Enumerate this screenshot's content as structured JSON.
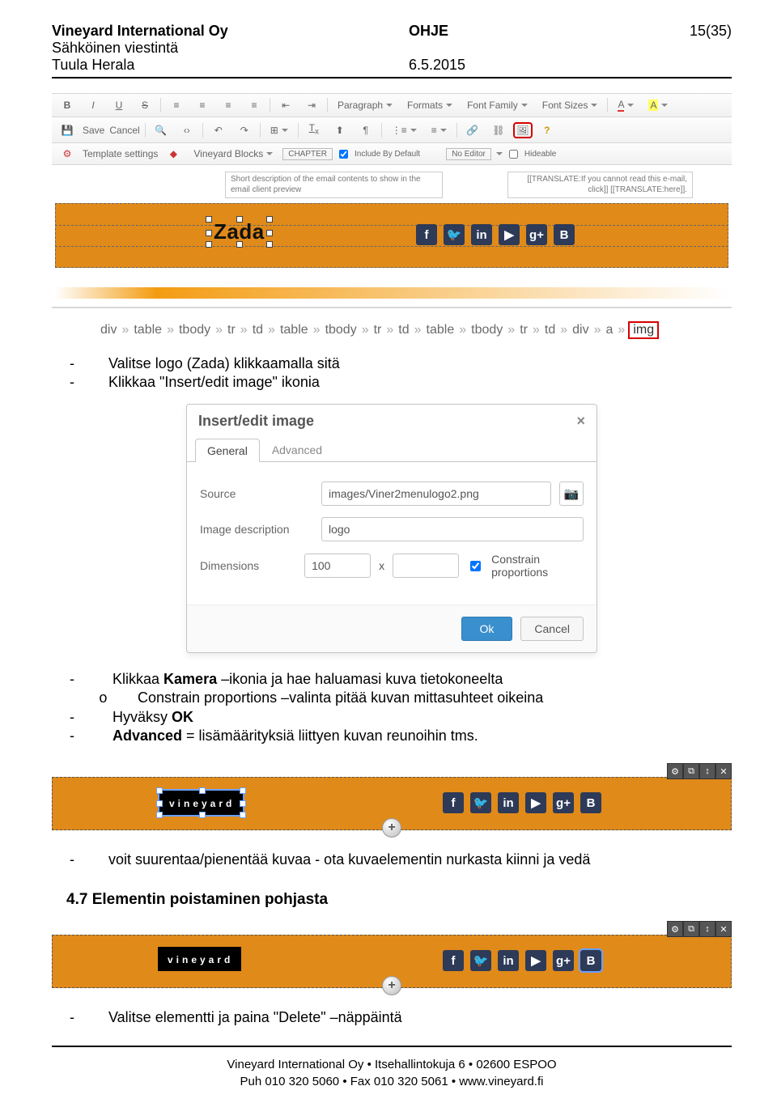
{
  "header": {
    "company": "Vineyard International Oy",
    "dept": "Sähköinen viestintä",
    "author": "Tuula Herala",
    "doctype": "OHJE",
    "date": "6.5.2015",
    "pages": "15(35)"
  },
  "editor": {
    "row1": {
      "bold": "B",
      "italic": "I",
      "underline": "U",
      "strike": "S",
      "paragraph": "Paragraph",
      "formats": "Formats",
      "fontfamily": "Font Family",
      "fontsizes": "Font Sizes",
      "acolor": "A",
      "abg": "A"
    },
    "row2": {
      "save": "Save",
      "cancel": "Cancel"
    },
    "row3": {
      "template": "Template settings",
      "blocks": "Vineyard Blocks",
      "chapter": "CHAPTER",
      "include": "Include By Default",
      "noeditor": "No Editor",
      "hideable": "Hideable"
    },
    "desc": "Short description of the email contents to show in the email client preview",
    "translate": "[[TRANSLATE:If you cannot read this e-mail, click]] [[TRANSLATE:here]].",
    "zada": "Zada"
  },
  "breadcrumb": [
    "div",
    "table",
    "tbody",
    "tr",
    "td",
    "table",
    "tbody",
    "tr",
    "td",
    "table",
    "tbody",
    "tr",
    "td",
    "div",
    "a",
    "img"
  ],
  "list1": {
    "i1a": "Valitse logo (Zada) klikkaamalla sitä",
    "i1b": "Klikkaa \"Insert/edit image\" ikonia"
  },
  "dialog": {
    "title": "Insert/edit image",
    "tabs": {
      "general": "General",
      "advanced": "Advanced"
    },
    "labels": {
      "source": "Source",
      "desc": "Image description",
      "dim": "Dimensions"
    },
    "values": {
      "source": "images/Viner2menulogo2.png",
      "desc": "logo",
      "w": "100",
      "x": "x",
      "constrain": "Constrain proportions"
    },
    "ok": "Ok",
    "cancel": "Cancel"
  },
  "list2": {
    "i1_pre": "Klikkaa ",
    "i1_b": "Kamera",
    "i1_post": " –ikonia ja hae haluamasi kuva tietokoneelta",
    "sub1": "Constrain proportions –valinta pitää kuvan mittasuhteet oikeina",
    "i2_pre": "Hyväksy ",
    "i2_b": "OK",
    "i3_b": "Advanced",
    "i3_post": " = lisämäärityksiä liittyen kuvan reunoihin tms."
  },
  "social": {
    "f": "f",
    "tw": "t",
    "in": "in",
    "yt": "▶",
    "gp": "g+",
    "b": "B"
  },
  "strip": {
    "logo": "vineyard"
  },
  "list3": {
    "i1": "voit suurentaa/pienentää kuvaa - ota kuvaelementin nurkasta kiinni ja vedä"
  },
  "section47": "4.7 Elementin poistaminen pohjasta",
  "list4": {
    "i1": "Valitse elementti ja paina \"Delete\" –näppäintä"
  },
  "footer": {
    "l1": "Vineyard International Oy • Itsehallintokuja 6 • 02600 ESPOO",
    "l2": "Puh 010 320 5060 • Fax 010 320 5061 • www.vineyard.fi"
  }
}
